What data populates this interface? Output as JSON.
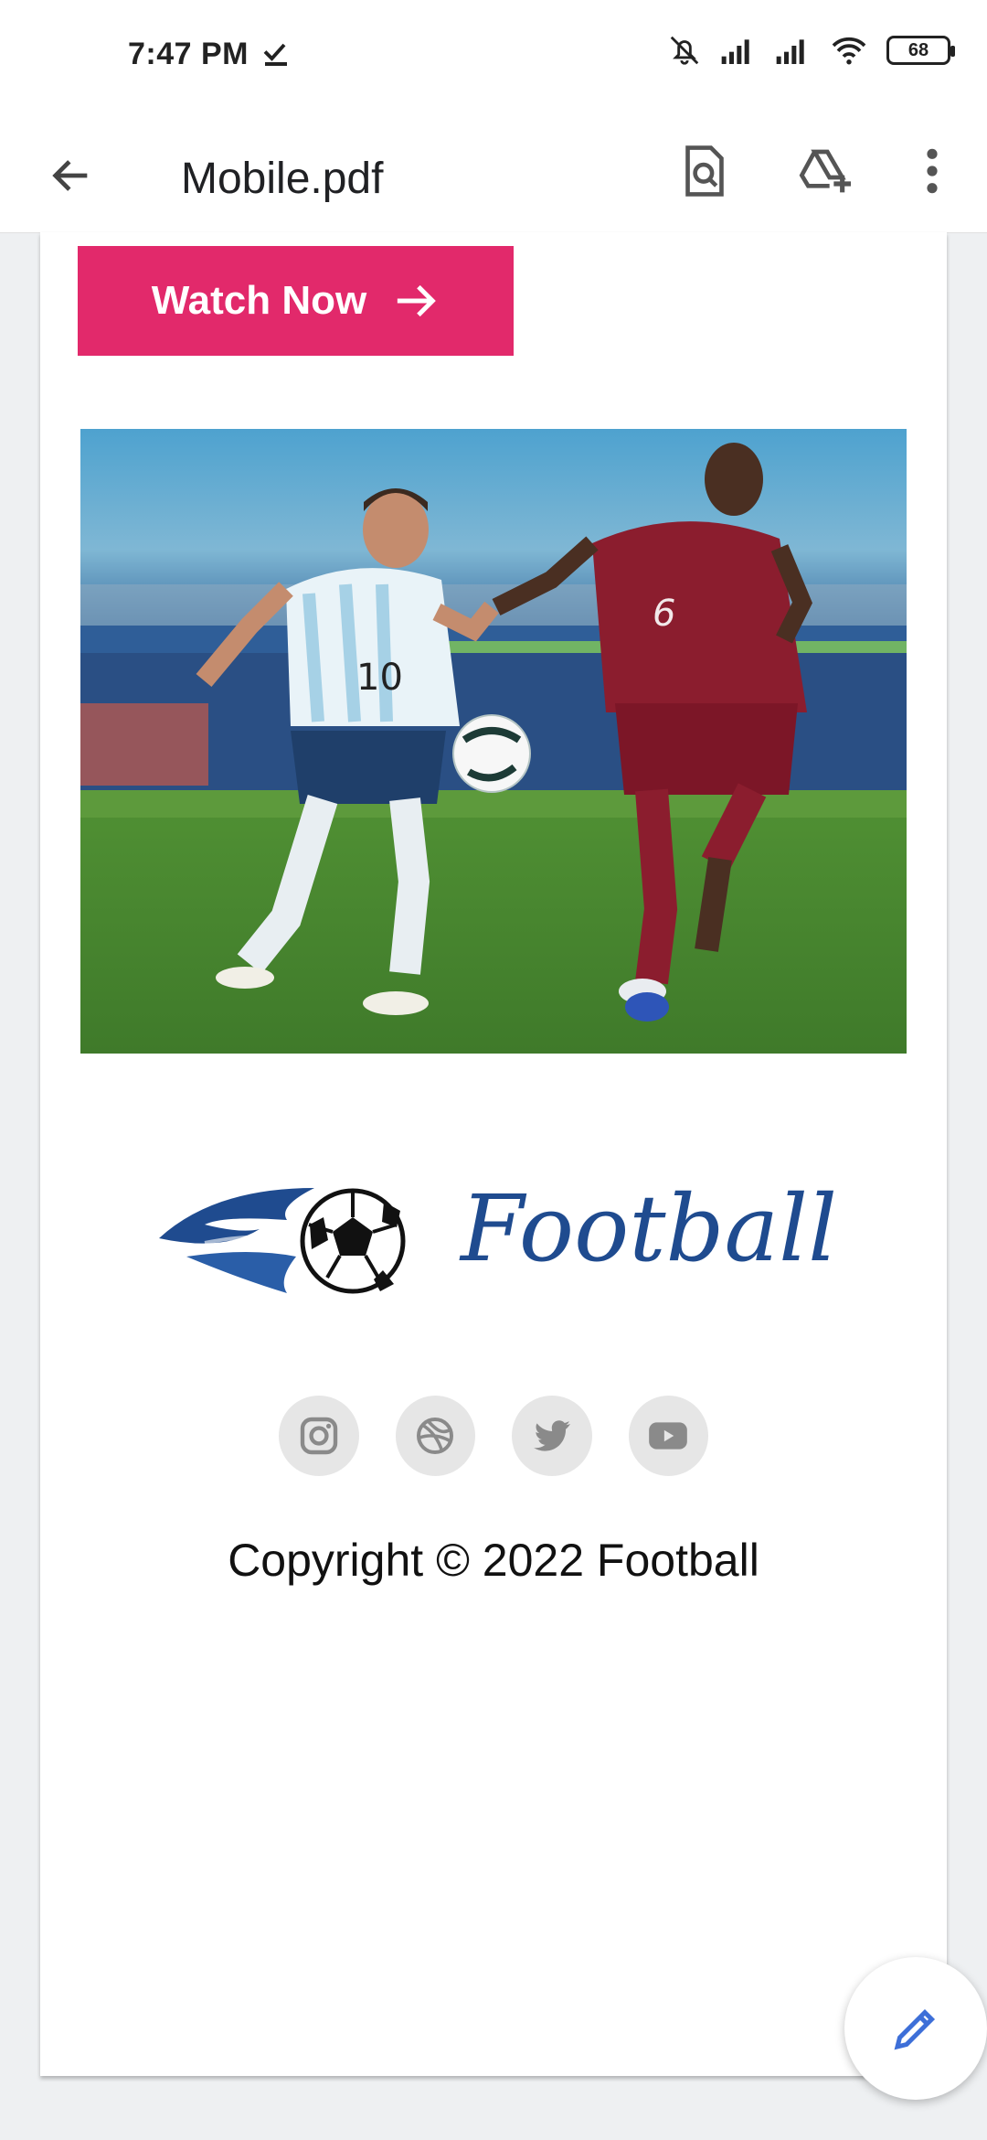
{
  "status_bar": {
    "time": "7:47 PM",
    "battery": "68",
    "icons": [
      "download-done-icon",
      "mute-bell-icon",
      "signal-icon",
      "signal-icon",
      "wifi-icon",
      "battery-icon"
    ]
  },
  "app_bar": {
    "title": "Mobile.pdf",
    "back_icon": "back-arrow-icon",
    "actions": [
      "find-in-document-icon",
      "add-to-drive-icon",
      "more-options-icon"
    ]
  },
  "document": {
    "watch_button": {
      "label": "Watch Now",
      "icon": "arrow-right-icon",
      "color": "#e2296b"
    },
    "hero_image": {
      "alt": "two-football-players-image"
    },
    "logo": {
      "text": "Football",
      "color": "#1f4b8f"
    },
    "social_icons": [
      "instagram-icon",
      "dribbble-icon",
      "twitter-icon",
      "youtube-icon"
    ],
    "copyright": "Copyright © 2022 Football"
  },
  "fab": {
    "icon": "edit-pencil-icon",
    "color": "#3d6fd8"
  }
}
